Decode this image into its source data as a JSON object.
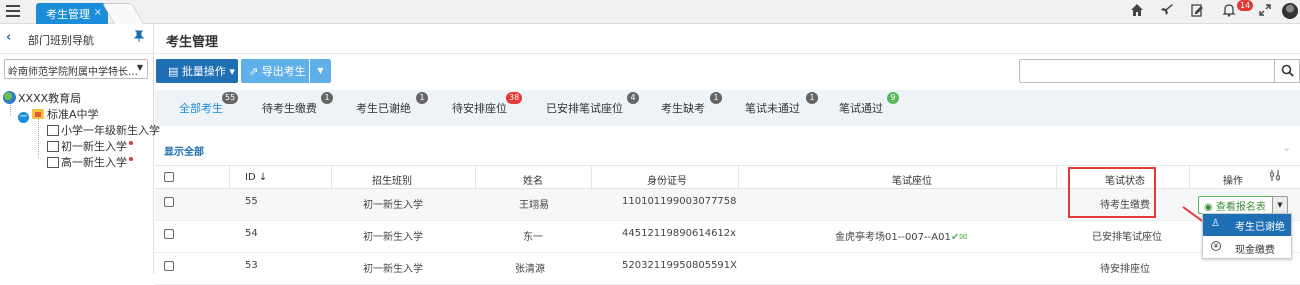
{
  "topbar": {
    "tab_label": "考生管理",
    "tab_close": "×",
    "notification_count": "14",
    "icons": [
      "home-icon",
      "rocket-icon",
      "edit-icon",
      "bell-icon",
      "fullscreen-icon",
      "avatar"
    ]
  },
  "sidebar": {
    "title": "部门班别导航",
    "school_select": "岭南师范学院附属中学特长…",
    "tree": {
      "root": "XXXX教育局",
      "school": "标准A中学",
      "classes": [
        "小学一年级新生入学",
        "初一新生入学",
        "高一新生入学"
      ]
    }
  },
  "main": {
    "page_title": "考生管理",
    "batch_button": "批量操作",
    "export_button": "导出考生",
    "search_placeholder": "",
    "filters": [
      {
        "label": "全部考生",
        "count": "55"
      },
      {
        "label": "待考生缴费",
        "count": "1"
      },
      {
        "label": "考生已谢绝",
        "count": "1"
      },
      {
        "label": "待安排座位",
        "count": "38"
      },
      {
        "label": "已安排笔试座位",
        "count": "4"
      },
      {
        "label": "考生缺考",
        "count": "1"
      },
      {
        "label": "笔试未通过",
        "count": "1"
      },
      {
        "label": "笔试通过",
        "count": "9"
      }
    ],
    "show_all": "显示全部",
    "table": {
      "headers": {
        "id": "ID",
        "class": "招生班别",
        "name": "姓名",
        "idcard": "身份证号",
        "seat": "笔试座位",
        "status": "笔试状态",
        "action": "操作"
      },
      "rows": [
        {
          "id": "55",
          "class": "初一新生入学",
          "name": "王翊易",
          "idcard": "110101199003077758",
          "seat": "",
          "status": "待考生缴费"
        },
        {
          "id": "54",
          "class": "初一新生入学",
          "name": "东一",
          "idcard": "44512119890614612x",
          "seat": "金虎亭考场01--007--A01",
          "status": "已安排笔试座位"
        },
        {
          "id": "53",
          "class": "初一新生入学",
          "name": "张清源",
          "idcard": "52032119950805591X",
          "seat": "",
          "status": "待安排座位"
        }
      ],
      "view_button": "查看报名表"
    },
    "dropdown": {
      "item1": "考生已谢绝",
      "item2": "现金缴费"
    }
  },
  "colors": {
    "primary": "#1a8cd8",
    "dark_primary": "#1e6fb4",
    "highlight": "#e53935",
    "success": "#5cb85c"
  }
}
